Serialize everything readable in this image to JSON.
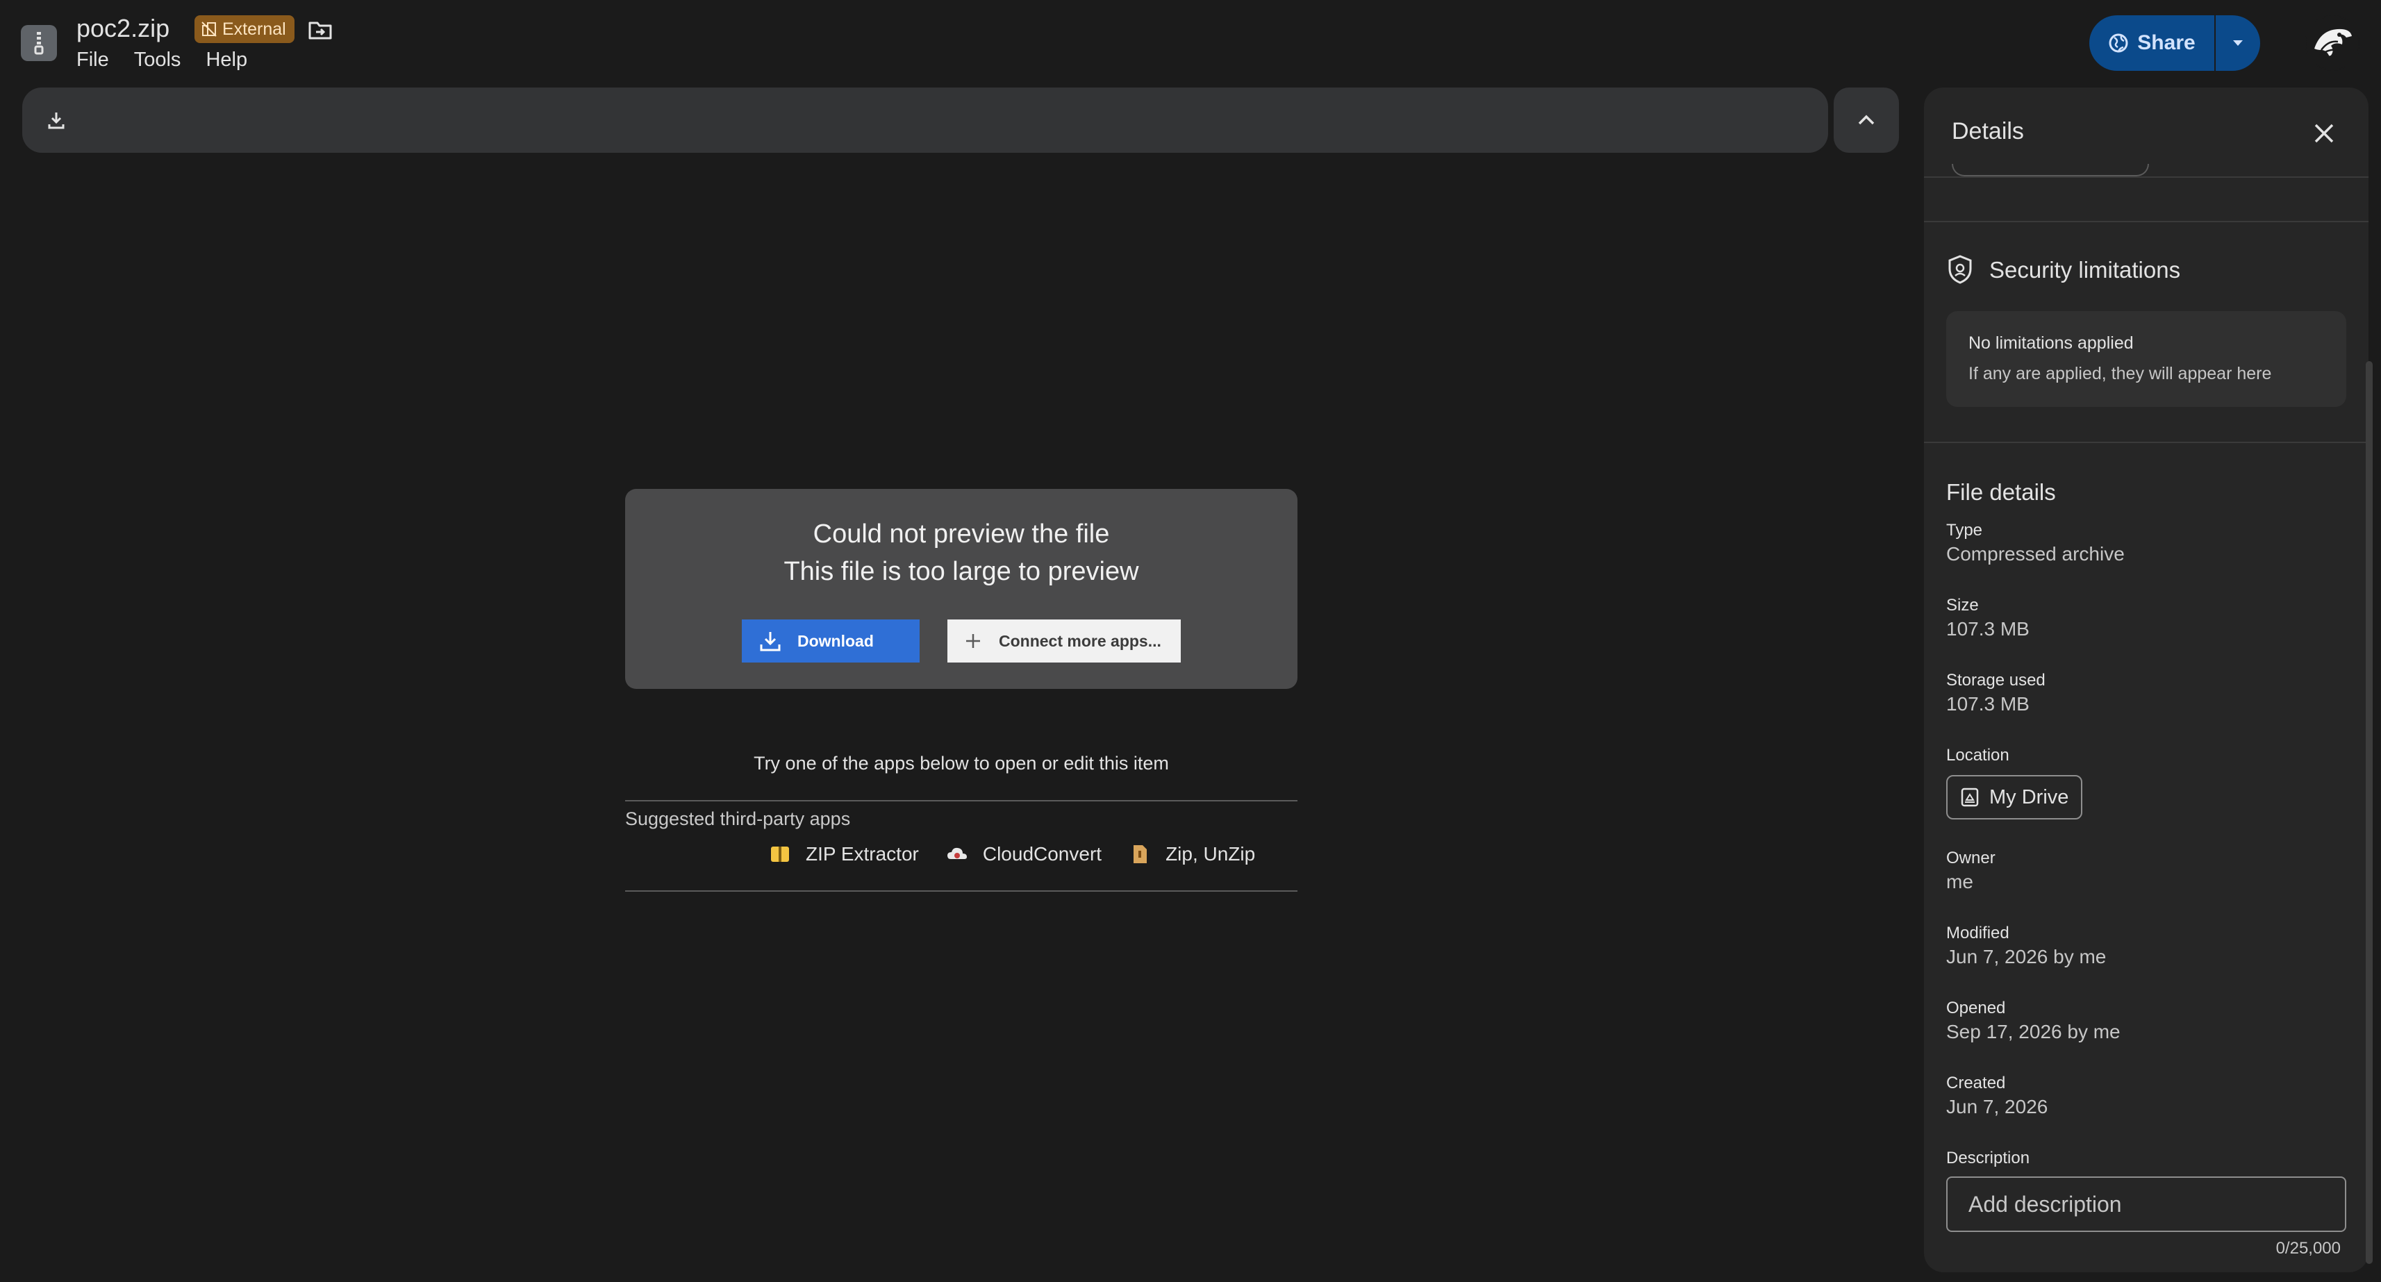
{
  "header": {
    "file_name": "poc2.zip",
    "external_badge": "External",
    "menu": [
      "File",
      "Tools",
      "Help"
    ],
    "share_label": "Share"
  },
  "preview": {
    "error_title": "Could not preview the file",
    "error_subtitle": "This file is too large to preview",
    "download_label": "Download",
    "connect_label": "Connect more apps...",
    "try_text": "Try one of the apps below to open or edit this item",
    "suggested_label": "Suggested third-party apps",
    "apps": [
      "ZIP Extractor",
      "CloudConvert",
      "Zip, UnZip"
    ]
  },
  "details": {
    "title": "Details",
    "security_title": "Security limitations",
    "limits_title": "No limitations applied",
    "limits_sub": "If any are applied, they will appear here",
    "file_details_title": "File details",
    "type_label": "Type",
    "type_value": "Compressed archive",
    "size_label": "Size",
    "size_value": "107.3 MB",
    "storage_label": "Storage used",
    "storage_value": "107.3 MB",
    "location_label": "Location",
    "location_value": "My Drive",
    "owner_label": "Owner",
    "owner_value": "me",
    "modified_label": "Modified",
    "modified_value": "Jun 7, 2026 by me",
    "opened_label": "Opened",
    "opened_value": "Sep 17, 2026 by me",
    "created_label": "Created",
    "created_value": "Jun 7, 2026",
    "description_label": "Description",
    "description_placeholder": "Add description",
    "description_counter": "0/25,000"
  }
}
